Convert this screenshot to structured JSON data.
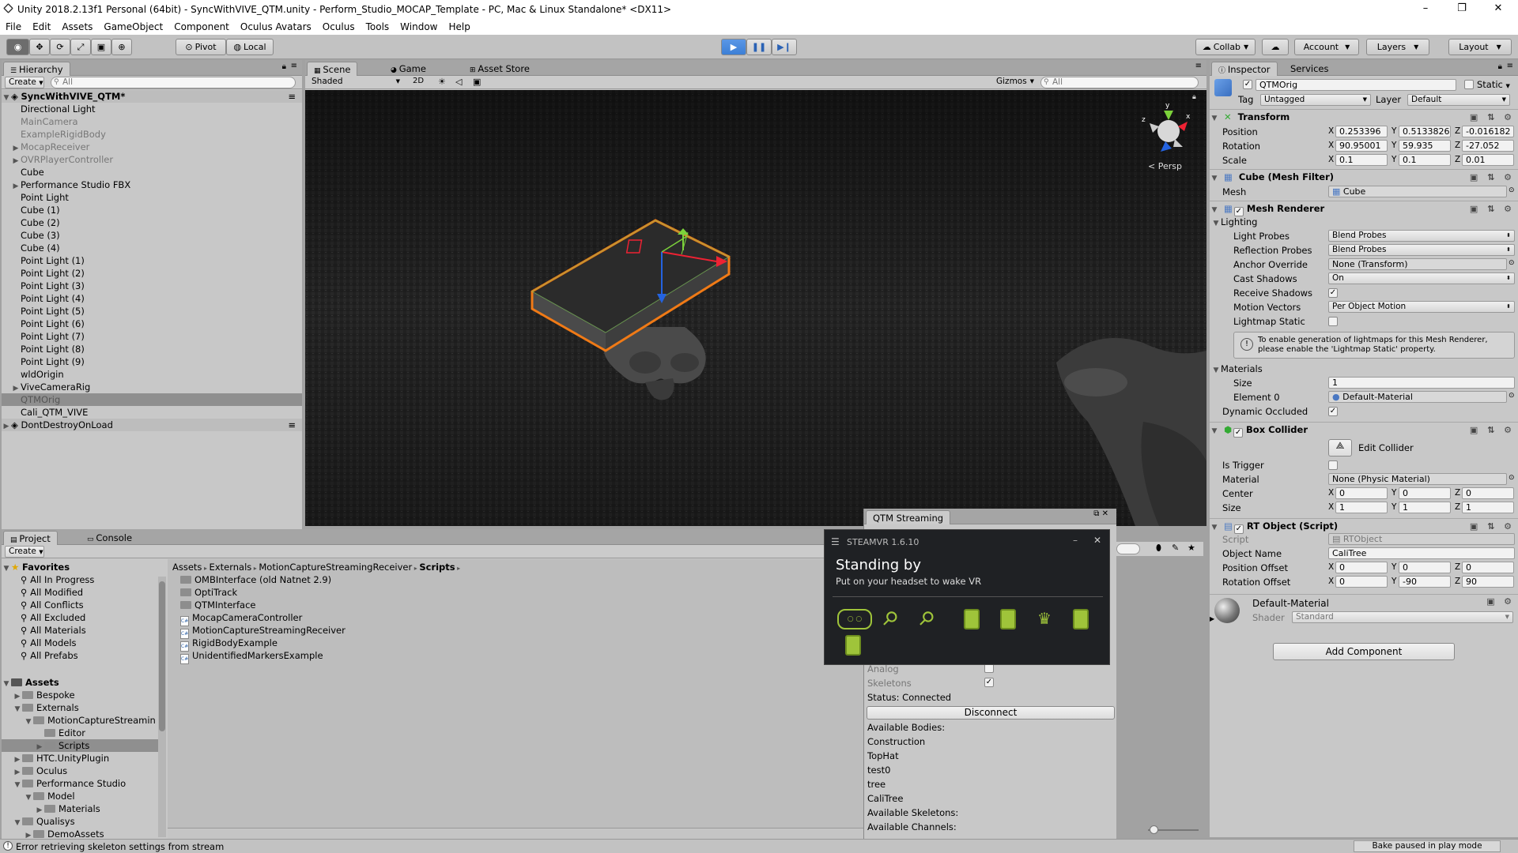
{
  "window": {
    "title": "Unity 2018.2.13f1 Personal (64bit) - SyncWithVIVE_QTM.unity - Perform_Studio_MOCAP_Template - PC, Mac & Linux Standalone* <DX11>",
    "minimize": "–",
    "maximize": "❐",
    "close": "✕"
  },
  "menu": [
    "File",
    "Edit",
    "Assets",
    "GameObject",
    "Component",
    "Oculus Avatars",
    "Oculus",
    "Tools",
    "Window",
    "Help"
  ],
  "toolbar": {
    "pivot": "Pivot",
    "local": "Local",
    "collab": "Collab",
    "account": "Account",
    "layers": "Layers",
    "layout": "Layout",
    "play_active": true
  },
  "hierarchy": {
    "tab": "Hierarchy",
    "create": "Create",
    "search_placeholder": "All",
    "scene": "SyncWithVIVE_QTM*",
    "items": [
      {
        "label": "Directional Light",
        "indent": 1,
        "arrow": "",
        "style": ""
      },
      {
        "label": "MainCamera",
        "indent": 1,
        "arrow": "",
        "style": "gray"
      },
      {
        "label": "ExampleRigidBody",
        "indent": 1,
        "arrow": "",
        "style": "gray"
      },
      {
        "label": "MocapReceiver",
        "indent": 1,
        "arrow": "▶",
        "style": "gray"
      },
      {
        "label": "OVRPlayerController",
        "indent": 1,
        "arrow": "▶",
        "style": "gray"
      },
      {
        "label": "Cube",
        "indent": 1,
        "arrow": "",
        "style": ""
      },
      {
        "label": "Performance Studio FBX",
        "indent": 1,
        "arrow": "▶",
        "style": ""
      },
      {
        "label": "Point Light",
        "indent": 1,
        "arrow": "",
        "style": ""
      },
      {
        "label": "Cube (1)",
        "indent": 1,
        "arrow": "",
        "style": ""
      },
      {
        "label": "Cube (2)",
        "indent": 1,
        "arrow": "",
        "style": ""
      },
      {
        "label": "Cube (3)",
        "indent": 1,
        "arrow": "",
        "style": ""
      },
      {
        "label": "Cube (4)",
        "indent": 1,
        "arrow": "",
        "style": ""
      },
      {
        "label": "Point Light (1)",
        "indent": 1,
        "arrow": "",
        "style": ""
      },
      {
        "label": "Point Light (2)",
        "indent": 1,
        "arrow": "",
        "style": ""
      },
      {
        "label": "Point Light (3)",
        "indent": 1,
        "arrow": "",
        "style": ""
      },
      {
        "label": "Point Light (4)",
        "indent": 1,
        "arrow": "",
        "style": ""
      },
      {
        "label": "Point Light (5)",
        "indent": 1,
        "arrow": "",
        "style": ""
      },
      {
        "label": "Point Light (6)",
        "indent": 1,
        "arrow": "",
        "style": ""
      },
      {
        "label": "Point Light (7)",
        "indent": 1,
        "arrow": "",
        "style": ""
      },
      {
        "label": "Point Light (8)",
        "indent": 1,
        "arrow": "",
        "style": ""
      },
      {
        "label": "Point Light (9)",
        "indent": 1,
        "arrow": "",
        "style": ""
      },
      {
        "label": "wldOrigin",
        "indent": 1,
        "arrow": "",
        "style": ""
      },
      {
        "label": "ViveCameraRig",
        "indent": 1,
        "arrow": "▶",
        "style": ""
      },
      {
        "label": "QTMOrig",
        "indent": 1,
        "arrow": "",
        "style": "selected"
      },
      {
        "label": "Cali_QTM_VIVE",
        "indent": 1,
        "arrow": "",
        "style": ""
      }
    ],
    "dont_destroy": "DontDestroyOnLoad"
  },
  "scene": {
    "tabs": [
      "Scene",
      "Game",
      "Asset Store"
    ],
    "shading": "Shaded",
    "mode2d": "2D",
    "gizmos": "Gizmos",
    "search_placeholder": "All",
    "persp": "< Persp"
  },
  "project": {
    "tabs": [
      "Project",
      "Console"
    ],
    "create": "Create",
    "favorites_header": "Favorites",
    "favorites": [
      "All In Progress",
      "All Modified",
      "All Conflicts",
      "All Excluded",
      "All Materials",
      "All Models",
      "All Prefabs"
    ],
    "assets_header": "Assets",
    "tree": [
      {
        "label": "Bespoke",
        "indent": 1,
        "arrow": "▶"
      },
      {
        "label": "Externals",
        "indent": 1,
        "arrow": "▼"
      },
      {
        "label": "MotionCaptureStreamin",
        "indent": 2,
        "arrow": "▼"
      },
      {
        "label": "Editor",
        "indent": 3,
        "arrow": ""
      },
      {
        "label": "Scripts",
        "indent": 3,
        "arrow": "▶",
        "selected": true
      },
      {
        "label": "HTC.UnityPlugin",
        "indent": 1,
        "arrow": "▶"
      },
      {
        "label": "Oculus",
        "indent": 1,
        "arrow": "▶"
      },
      {
        "label": "Performance Studio",
        "indent": 1,
        "arrow": "▼"
      },
      {
        "label": "Model",
        "indent": 2,
        "arrow": "▼"
      },
      {
        "label": "Materials",
        "indent": 3,
        "arrow": "▶"
      },
      {
        "label": "Qualisys",
        "indent": 1,
        "arrow": "▼"
      },
      {
        "label": "DemoAssets",
        "indent": 2,
        "arrow": "▶"
      }
    ],
    "breadcrumb": [
      "Assets",
      "Externals",
      "MotionCaptureStreamingReceiver",
      "Scripts"
    ],
    "files": [
      {
        "label": "OMBInterface (old Natnet 2.9)",
        "kind": "folder"
      },
      {
        "label": "OptiTrack",
        "kind": "folder"
      },
      {
        "label": "QTMInterface",
        "kind": "folder"
      },
      {
        "label": "MocapCameraController",
        "kind": "script"
      },
      {
        "label": "MotionCaptureStreamingReceiver",
        "kind": "script"
      },
      {
        "label": "RigidBodyExample",
        "kind": "script"
      },
      {
        "label": "UnidentifiedMarkersExample",
        "kind": "script"
      }
    ]
  },
  "qtm": {
    "tab": "QTM Streaming",
    "analog": "Analog",
    "analog_checked": false,
    "skeletons": "Skeletons",
    "skeletons_checked": true,
    "status": "Status: Connected",
    "disconnect": "Disconnect",
    "available_bodies": "Available Bodies:",
    "bodies": [
      "Construction",
      "TopHat",
      "test0",
      "tree",
      "CaliTree"
    ],
    "available_skeletons": "Available Skeletons:",
    "available_channels": "Available Channels:"
  },
  "steamvr": {
    "title": "STEAMVR 1.6.10",
    "heading": "Standing by",
    "sub": "Put on your headset to wake VR",
    "minimize": "–",
    "close": "✕",
    "device_color": "#9fc43a"
  },
  "inspector": {
    "tabs": [
      "Inspector",
      "Services"
    ],
    "object_name": "QTMOrig",
    "static": "Static",
    "tag_label": "Tag",
    "tag": "Untagged",
    "layer_label": "Layer",
    "layer": "Default",
    "transform": {
      "title": "Transform",
      "position_label": "Position",
      "rotation_label": "Rotation",
      "scale_label": "Scale",
      "position": [
        "0.253396",
        "0.5133826",
        "-0.016182"
      ],
      "rotation": [
        "90.95001",
        "59.935",
        "-27.052"
      ],
      "scale": [
        "0.1",
        "0.1",
        "0.01"
      ]
    },
    "mesh_filter": {
      "title": "Cube (Mesh Filter)",
      "mesh_label": "Mesh",
      "mesh": "Cube"
    },
    "mesh_renderer": {
      "title": "Mesh Renderer",
      "lighting": "Lighting",
      "light_probes_label": "Light Probes",
      "light_probes": "Blend Probes",
      "reflection_probes_label": "Reflection Probes",
      "reflection_probes": "Blend Probes",
      "anchor_label": "Anchor Override",
      "anchor": "None (Transform)",
      "cast_label": "Cast Shadows",
      "cast": "On",
      "receive_label": "Receive Shadows",
      "motion_label": "Motion Vectors",
      "motion": "Per Object Motion",
      "lightmap_label": "Lightmap Static",
      "info": "To enable generation of lightmaps for this Mesh Renderer, please enable the 'Lightmap Static' property.",
      "materials": "Materials",
      "size_label": "Size",
      "size": "1",
      "element_label": "Element 0",
      "element": "Default-Material",
      "dynamic_label": "Dynamic Occluded"
    },
    "box_collider": {
      "title": "Box Collider",
      "edit": "Edit Collider",
      "trigger_label": "Is Trigger",
      "material_label": "Material",
      "material": "None (Physic Material)",
      "center_label": "Center",
      "center": [
        "0",
        "0",
        "0"
      ],
      "size_label": "Size",
      "size": [
        "1",
        "1",
        "1"
      ]
    },
    "rt_object": {
      "title": "RT Object (Script)",
      "script_label": "Script",
      "script": "RTObject",
      "name_label": "Object Name",
      "name": "CaliTree",
      "pos_label": "Position Offset",
      "pos": [
        "0",
        "0",
        "0"
      ],
      "rot_label": "Rotation Offset",
      "rot": [
        "0",
        "-90",
        "90"
      ]
    },
    "material": {
      "name": "Default-Material",
      "shader_label": "Shader",
      "shader": "Standard"
    },
    "add_component": "Add Component"
  },
  "statusbar": {
    "error": "Error retrieving skeleton settings from stream",
    "bake": "Bake paused in play mode"
  },
  "colors": {
    "accent_play": "#3c7fd6",
    "selection_outline": "#f07a16"
  }
}
